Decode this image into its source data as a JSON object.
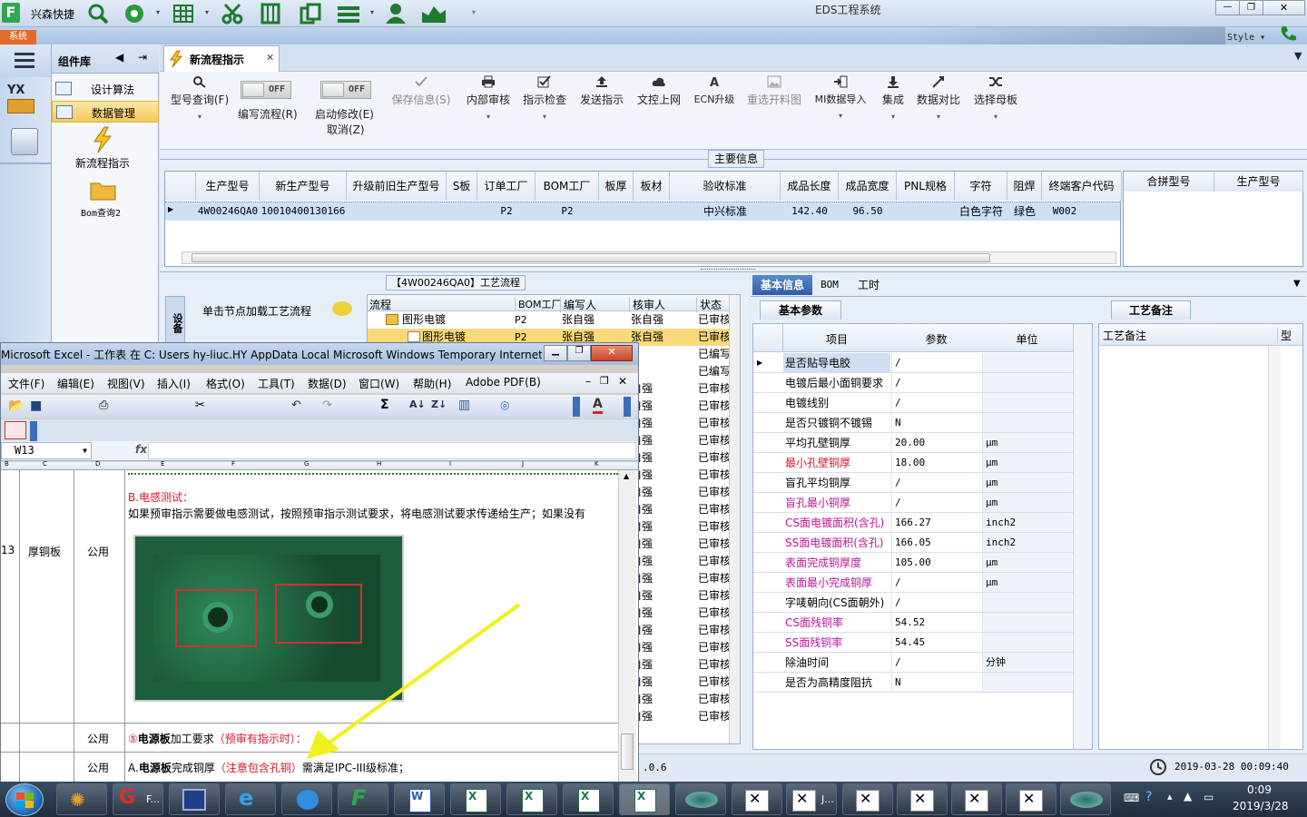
{
  "app": {
    "quick_label": "兴森快捷",
    "title": "EDS工程系统",
    "sys_tab": "系统",
    "style_label": "Style"
  },
  "component_panel": {
    "title": "组件库",
    "items": [
      {
        "label": "设计算法"
      },
      {
        "label": "数据管理"
      }
    ],
    "big_buttons": [
      {
        "label": "新流程指示"
      },
      {
        "label": "Bom查询2"
      }
    ]
  },
  "tab": {
    "label": "新流程指示"
  },
  "ribbon": {
    "buttons": [
      {
        "label": "型号查询(F)",
        "icon": "search-icon"
      },
      {
        "label": "编写流程(R)",
        "toggle": "OFF"
      },
      {
        "label": "启动修改(E)",
        "sub": "取消(Z)",
        "toggle": "OFF"
      },
      {
        "label": "保存信息(S)",
        "icon": "check-icon",
        "disabled": true
      },
      {
        "label": "内部审核",
        "icon": "printer-icon"
      },
      {
        "label": "指示检查",
        "icon": "checkbox-icon"
      },
      {
        "label": "发送指示",
        "icon": "upload-icon"
      },
      {
        "label": "文控上网",
        "icon": "cloud-upload-icon"
      },
      {
        "label": "ECN升级",
        "icon": "a-icon"
      },
      {
        "label": "重选开料图",
        "icon": "image-icon",
        "disabled": true
      },
      {
        "label": "MI数据导入",
        "icon": "import-icon"
      },
      {
        "label": "集成",
        "icon": "download-icon"
      },
      {
        "label": "数据对比",
        "icon": "compare-icon"
      },
      {
        "label": "选择母板",
        "icon": "shuffle-icon"
      }
    ]
  },
  "main_info": {
    "title": "主要信息",
    "columns": [
      "生产型号",
      "新生产型号",
      "升级前旧生产型号",
      "S板",
      "订单工厂",
      "BOM工厂",
      "板厚",
      "板材",
      "验收标准",
      "成品长度",
      "成品宽度",
      "PNL规格",
      "字符",
      "阻焊",
      "终端客户代码"
    ],
    "row": [
      "4W00246QA0",
      "10010400130166",
      "",
      "",
      "P2",
      "P2",
      "",
      "",
      "中兴标准",
      "142.40",
      "96.50",
      "",
      "白色字符",
      "绿色",
      "W002"
    ],
    "side_columns": [
      "合拼型号",
      "生产型号"
    ]
  },
  "process": {
    "title": "【4W00246QA0】工艺流程",
    "side_tab": "设备",
    "load_label": "单击节点加载工艺流程",
    "columns": [
      "流程",
      "BOM工厂",
      "编写人",
      "核审人",
      "状态"
    ],
    "rows": [
      [
        "图形电镀",
        "P2",
        "张自强",
        "张自强",
        "已审核"
      ],
      [
        "图形电镀",
        "P2",
        "张自强",
        "张自强",
        "已审核"
      ],
      [
        "",
        "",
        "",
        "",
        "已编写"
      ],
      [
        "",
        "",
        "",
        "",
        "已编写"
      ],
      [
        "",
        "",
        "",
        "自强",
        "已审核"
      ],
      [
        "",
        "",
        "",
        "自强",
        "已审核"
      ],
      [
        "",
        "",
        "",
        "自强",
        "已审核"
      ],
      [
        "",
        "",
        "",
        "自强",
        "已审核"
      ],
      [
        "",
        "",
        "",
        "自强",
        "已审核"
      ],
      [
        "",
        "",
        "",
        "自强",
        "已审核"
      ],
      [
        "",
        "",
        "",
        "自强",
        "已审核"
      ],
      [
        "",
        "",
        "",
        "自强",
        "已审核"
      ],
      [
        "",
        "",
        "",
        "自强",
        "已审核"
      ],
      [
        "",
        "",
        "",
        "自强",
        "已审核"
      ],
      [
        "",
        "",
        "",
        "自强",
        "已审核"
      ],
      [
        "",
        "",
        "",
        "自强",
        "已审核"
      ],
      [
        "",
        "",
        "",
        "自强",
        "已审核"
      ],
      [
        "",
        "",
        "",
        "自强",
        "已审核"
      ],
      [
        "",
        "",
        "",
        "自强",
        "已审核"
      ],
      [
        "",
        "",
        "",
        "自强",
        "已审核"
      ],
      [
        "",
        "",
        "",
        "自强",
        "已审核"
      ],
      [
        "",
        "",
        "",
        "自强",
        "已审核"
      ],
      [
        "",
        "",
        "",
        "自强",
        "已审核"
      ],
      [
        "",
        "",
        "",
        "自强",
        "已审核"
      ]
    ]
  },
  "detail": {
    "tabs": [
      "基本信息",
      "BOM",
      "工时"
    ],
    "subtab": "基本参数",
    "columns": [
      "项目",
      "参数",
      "单位"
    ],
    "rows": [
      {
        "item": "是否贴导电胶",
        "value": "/",
        "unit": "",
        "color": "black"
      },
      {
        "item": "电镀后最小面铜要求",
        "value": "/",
        "unit": "",
        "color": "black"
      },
      {
        "item": "电镀线别",
        "value": "/",
        "unit": "",
        "color": "black"
      },
      {
        "item": "是否只镀铜不镀锡",
        "value": "N",
        "unit": "",
        "color": "black"
      },
      {
        "item": "平均孔壁铜厚",
        "value": "20.00",
        "unit": "μm",
        "color": "black"
      },
      {
        "item": "最小孔壁铜厚",
        "value": "18.00",
        "unit": "μm",
        "color": "red"
      },
      {
        "item": "盲孔平均铜厚",
        "value": "/",
        "unit": "μm",
        "color": "black"
      },
      {
        "item": "盲孔最小铜厚",
        "value": "/",
        "unit": "μm",
        "color": "mag"
      },
      {
        "item": "CS面电镀面积(含孔)",
        "value": "166.27",
        "unit": "inch2",
        "color": "mag"
      },
      {
        "item": "SS面电镀面积(含孔)",
        "value": "166.05",
        "unit": "inch2",
        "color": "mag"
      },
      {
        "item": "表面完成铜厚度",
        "value": "105.00",
        "unit": "μm",
        "color": "mag"
      },
      {
        "item": "表面最小完成铜厚",
        "value": "/",
        "unit": "μm",
        "color": "mag"
      },
      {
        "item": "字唛朝向(CS面朝外)",
        "value": "/",
        "unit": "",
        "color": "black"
      },
      {
        "item": "CS面残铜率",
        "value": "54.52",
        "unit": "",
        "color": "mag"
      },
      {
        "item": "SS面残铜率",
        "value": "54.45",
        "unit": "",
        "color": "mag"
      },
      {
        "item": "除油时间",
        "value": "/",
        "unit": "分钟",
        "color": "black"
      },
      {
        "item": "是否为高精度阻抗",
        "value": "N",
        "unit": "",
        "color": "black"
      }
    ]
  },
  "remarks": {
    "tab": "工艺备注",
    "col1": "工艺备注",
    "col2": "型"
  },
  "status": {
    "version": ".0.6",
    "datetime": "2019-03-28 00:09:40"
  },
  "excel": {
    "title": "Microsoft Excel - 工作表 在 C: Users hy-liuc.HY AppData Local Microsoft Windows Temporary Internet ...",
    "menus": [
      "文件(F)",
      "编辑(E)",
      "视图(V)",
      "插入(I)",
      "格式(O)",
      "工具(T)",
      "数据(D)",
      "窗口(W)",
      "帮助(H)",
      "Adobe PDF(B)"
    ],
    "namebox": "W13",
    "fx": "fx",
    "col_headers": [
      "B",
      "C",
      "D",
      "E",
      "F",
      "G",
      "H",
      "I",
      "J",
      "K"
    ],
    "row_num": "13",
    "cell_c": "厚铜板",
    "cell_d": "公用",
    "section_b_title": "B.电感测试：",
    "section_b_text": "如果预审指示需要做电感测试，按照预审指示测试要求，将电感测试要求传递给生产；如果没有",
    "row2_d": "公用",
    "row2_prefix": "⑤",
    "row2_bold": "电源板",
    "row2_text": "加工要求",
    "row2_red": "（预审有指示时）：",
    "row3_d": "公用",
    "row3_a": "A.",
    "row3_bold": "电源板",
    "row3_text": "完成铜厚",
    "row3_red": "（注意包含孔铜）",
    "row3_tail": "需满足IPC-III级标准；"
  },
  "taskbar": {
    "time": "0:09",
    "date": "2019/3/28",
    "f_label": "F...",
    "j_label": "J..."
  }
}
